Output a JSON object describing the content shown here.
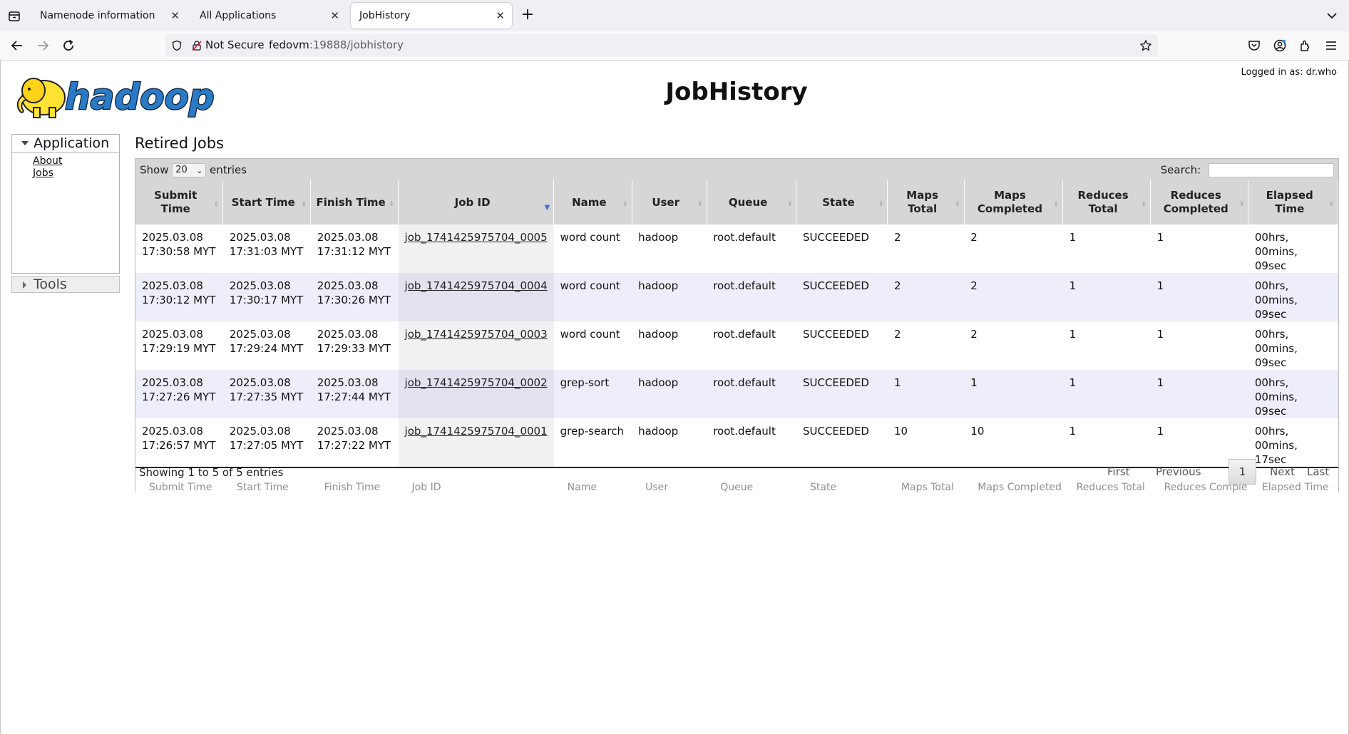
{
  "browser": {
    "tabs": [
      {
        "label": "Namenode information"
      },
      {
        "label": "All Applications"
      },
      {
        "label": "JobHistory"
      }
    ],
    "url": {
      "security_label": "Not Secure",
      "host": "fedovm",
      "path": ":19888/jobhistory"
    }
  },
  "header": {
    "title": "JobHistory",
    "logged_in": "Logged in as: dr.who",
    "logo_text": "hadoop"
  },
  "sidebar": {
    "application_label": "Application",
    "links": [
      "About",
      "Jobs"
    ],
    "tools_label": "Tools"
  },
  "main": {
    "section_title": "Retired Jobs",
    "show_label": "Show",
    "entries_value": "20",
    "entries_label": "entries",
    "search_label": "Search:",
    "columns": [
      "Submit Time",
      "Start Time",
      "Finish Time",
      "Job ID",
      "Name",
      "User",
      "Queue",
      "State",
      "Maps Total",
      "Maps Completed",
      "Reduces Total",
      "Reduces Completed",
      "Elapsed Time"
    ],
    "footer_columns": [
      "Submit Time",
      "Start Time",
      "Finish Time",
      "Job ID",
      "Name",
      "User",
      "Queue",
      "State",
      "Maps Total",
      "Maps Completed",
      "Reduces Total",
      "Reduces Comple",
      "Elapsed Time"
    ],
    "rows": [
      {
        "submit": "2025.03.08 17:30:58 MYT",
        "start": "2025.03.08 17:31:03 MYT",
        "finish": "2025.03.08 17:31:12 MYT",
        "job_id": "job_1741425975704_0005",
        "name": "word count",
        "user": "hadoop",
        "queue": "root.default",
        "state": "SUCCEEDED",
        "maps_total": "2",
        "maps_completed": "2",
        "reduces_total": "1",
        "reduces_completed": "1",
        "elapsed": "00hrs, 00mins, 09sec"
      },
      {
        "submit": "2025.03.08 17:30:12 MYT",
        "start": "2025.03.08 17:30:17 MYT",
        "finish": "2025.03.08 17:30:26 MYT",
        "job_id": "job_1741425975704_0004",
        "name": "word count",
        "user": "hadoop",
        "queue": "root.default",
        "state": "SUCCEEDED",
        "maps_total": "2",
        "maps_completed": "2",
        "reduces_total": "1",
        "reduces_completed": "1",
        "elapsed": "00hrs, 00mins, 09sec"
      },
      {
        "submit": "2025.03.08 17:29:19 MYT",
        "start": "2025.03.08 17:29:24 MYT",
        "finish": "2025.03.08 17:29:33 MYT",
        "job_id": "job_1741425975704_0003",
        "name": "word count",
        "user": "hadoop",
        "queue": "root.default",
        "state": "SUCCEEDED",
        "maps_total": "2",
        "maps_completed": "2",
        "reduces_total": "1",
        "reduces_completed": "1",
        "elapsed": "00hrs, 00mins, 09sec"
      },
      {
        "submit": "2025.03.08 17:27:26 MYT",
        "start": "2025.03.08 17:27:35 MYT",
        "finish": "2025.03.08 17:27:44 MYT",
        "job_id": "job_1741425975704_0002",
        "name": "grep-sort",
        "user": "hadoop",
        "queue": "root.default",
        "state": "SUCCEEDED",
        "maps_total": "1",
        "maps_completed": "1",
        "reduces_total": "1",
        "reduces_completed": "1",
        "elapsed": "00hrs, 00mins, 09sec"
      },
      {
        "submit": "2025.03.08 17:26:57 MYT",
        "start": "2025.03.08 17:27:05 MYT",
        "finish": "2025.03.08 17:27:22 MYT",
        "job_id": "job_1741425975704_0001",
        "name": "grep-search",
        "user": "hadoop",
        "queue": "root.default",
        "state": "SUCCEEDED",
        "maps_total": "10",
        "maps_completed": "10",
        "reduces_total": "1",
        "reduces_completed": "1",
        "elapsed": "00hrs, 00mins, 17sec"
      }
    ],
    "info": "Showing 1 to 5 of 5 entries",
    "pager": {
      "first": "First",
      "previous": "Previous",
      "current": "1",
      "next": "Next",
      "last": "Last"
    }
  }
}
